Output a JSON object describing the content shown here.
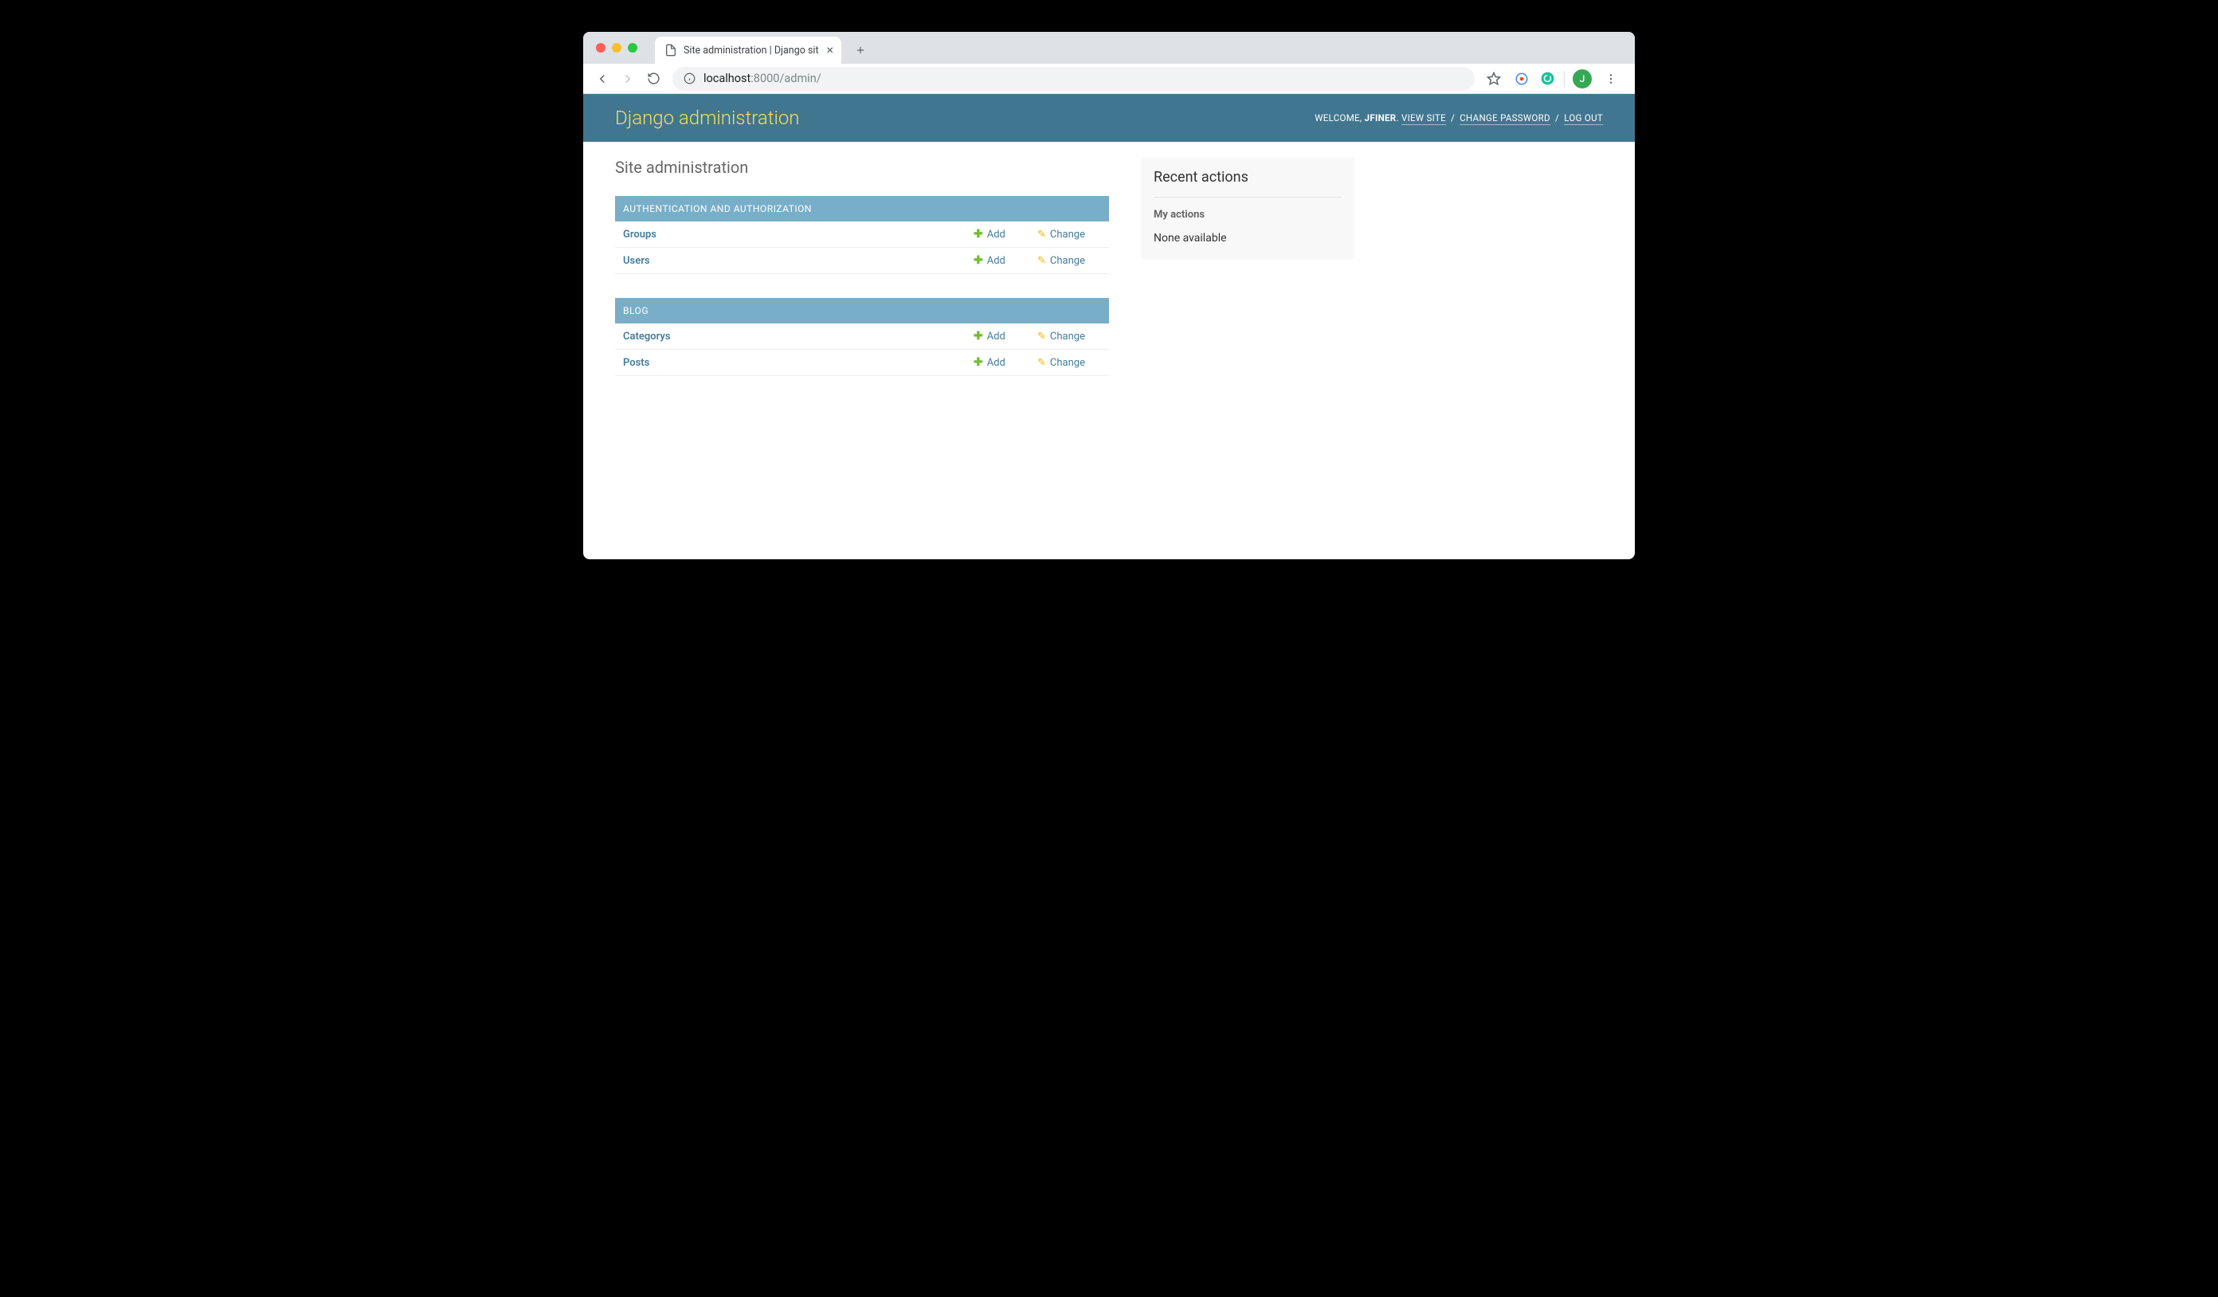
{
  "browser": {
    "tab_title": "Site administration | Django sit",
    "url_host": "localhost",
    "url_port_path": ":8000/admin/",
    "avatar_initial": "J"
  },
  "header": {
    "brand": "Django administration",
    "welcome": "WELCOME, ",
    "username": "JFINER",
    "view_site": "VIEW SITE",
    "change_password": "CHANGE PASSWORD",
    "log_out": "LOG OUT"
  },
  "page_heading": "Site administration",
  "modules": [
    {
      "name": "AUTHENTICATION AND AUTHORIZATION",
      "rows": [
        {
          "label": "Groups",
          "add": "Add",
          "change": "Change"
        },
        {
          "label": "Users",
          "add": "Add",
          "change": "Change"
        }
      ]
    },
    {
      "name": "BLOG",
      "rows": [
        {
          "label": "Categorys",
          "add": "Add",
          "change": "Change"
        },
        {
          "label": "Posts",
          "add": "Add",
          "change": "Change"
        }
      ]
    }
  ],
  "sidebar": {
    "title": "Recent actions",
    "subtitle": "My actions",
    "none": "None available"
  }
}
